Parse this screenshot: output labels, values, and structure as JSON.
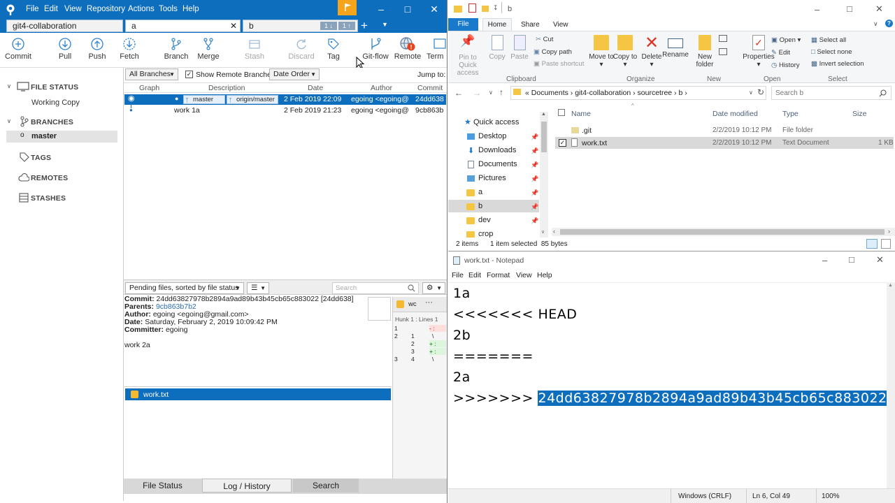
{
  "sourcetree": {
    "menu": [
      "File",
      "Edit",
      "View",
      "Repository",
      "Actions",
      "Tools",
      "Help"
    ],
    "tabs": [
      {
        "label": "git4-collaboration"
      },
      {
        "label": "a",
        "close": "✕"
      },
      {
        "label": "b",
        "badge1": "1 ↓",
        "badge2": "1 ↑"
      }
    ],
    "toolbar": [
      "Commit",
      "Pull",
      "Push",
      "Fetch",
      "Branch",
      "Merge",
      "Stash",
      "Discard",
      "Tag",
      "Git-flow",
      "Remote",
      "Term"
    ],
    "sidebar": {
      "file_status": "FILE STATUS",
      "working_copy": "Working Copy",
      "branches": "BRANCHES",
      "master": "master",
      "tags": "TAGS",
      "remotes": "REMOTES",
      "stashes": "STASHES"
    },
    "filters": {
      "all_branches": "All Branches",
      "show_remote": "Show Remote Branches",
      "date_order": "Date Order",
      "jump_to": "Jump to:"
    },
    "columns": [
      "Graph",
      "Description",
      "Date",
      "Author",
      "Commit"
    ],
    "commits": [
      {
        "tag1": "master",
        "tag2": "origin/master",
        "date": "2 Feb 2019 22:09",
        "author": "egoing <egoing@",
        "hash": "24dd638"
      },
      {
        "desc": "work 1a",
        "date": "2 Feb 2019 21:23",
        "author": "egoing <egoing@",
        "hash": "9cb863b"
      }
    ],
    "pending_files": "Pending files, sorted by file status",
    "search_placeholder": "Search",
    "details": {
      "commit_label": "Commit:",
      "commit_value": "24dd63827978b2894a9ad89b43b45cb65c883022 [24dd638]",
      "parents_label": "Parents:",
      "parents_value": "9cb863b7b2",
      "author_label": "Author:",
      "author_value": "egoing <egoing@gmail.com>",
      "date_label": "Date:",
      "date_value": "Saturday, February 2, 2019 10:09:42 PM",
      "committer_label": "Committer:",
      "committer_value": "egoing",
      "message": "work 2a"
    },
    "file": "work.txt",
    "diff": {
      "file": "wc",
      "hunk": "Hunk 1 : Lines 1",
      "rows": [
        {
          "l": "1",
          "r": "",
          "s": "- :"
        },
        {
          "l": "2",
          "r": "1",
          "s": "\\"
        },
        {
          "l": "",
          "r": "2",
          "s": "+ :"
        },
        {
          "l": "",
          "r": "3",
          "s": "+ :"
        },
        {
          "l": "3",
          "r": "4",
          "s": "\\"
        }
      ]
    },
    "bottom_tabs": [
      "File Status",
      "Log / History",
      "Search"
    ]
  },
  "explorer": {
    "title": "b",
    "tabs": [
      "File",
      "Home",
      "Share",
      "View"
    ],
    "ribbon": {
      "pin": "Pin to Quick access",
      "copy": "Copy",
      "paste": "Paste",
      "cut": "Cut",
      "copy_path": "Copy path",
      "paste_shortcut": "Paste shortcut",
      "move_to": "Move to ▾",
      "copy_to": "Copy to ▾",
      "delete": "Delete ▾",
      "rename": "Rename",
      "new_folder": "New folder",
      "properties": "Properties ▾",
      "open": "Open ▾",
      "edit": "Edit",
      "history": "History",
      "select_all": "Select all",
      "select_none": "Select none",
      "invert_selection": "Invert selection"
    },
    "groups": [
      "Clipboard",
      "Organize",
      "New",
      "Open",
      "Select"
    ],
    "path": [
      "Documents",
      "git4-collaboration",
      "sourcetree",
      "b"
    ],
    "search_placeholder": "Search b",
    "nav": [
      {
        "label": "Quick access"
      },
      {
        "label": "Desktop"
      },
      {
        "label": "Downloads"
      },
      {
        "label": "Documents"
      },
      {
        "label": "Pictures"
      },
      {
        "label": "a"
      },
      {
        "label": "b"
      },
      {
        "label": "dev"
      },
      {
        "label": "crop"
      }
    ],
    "columns": [
      "Name",
      "Date modified",
      "Type",
      "Size"
    ],
    "files": [
      {
        "name": ".git",
        "date": "2/2/2019 10:12 PM",
        "type": "File folder",
        "size": ""
      },
      {
        "name": "work.txt",
        "date": "2/2/2019 10:12 PM",
        "type": "Text Document",
        "size": "1 KB"
      }
    ],
    "status": {
      "items": "2 items",
      "selected": "1 item selected  85 bytes"
    }
  },
  "notepad": {
    "title": "work.txt - Notepad",
    "menu": [
      "File",
      "Edit",
      "Format",
      "View",
      "Help"
    ],
    "lines": [
      "1a",
      "<<<<<<< HEAD",
      "2b",
      "=======",
      "2a"
    ],
    "last_prefix": ">>>>>>> ",
    "last_hash": "24dd63827978b2894a9ad89b43b45cb65c883022",
    "status": {
      "eol": "Windows (CRLF)",
      "pos": "Ln 6, Col 49",
      "zoom": "100%"
    }
  },
  "colors": {
    "accent": "#0e6ebe",
    "remote_badge": "#e8411c",
    "flag": "#f7a41d"
  }
}
